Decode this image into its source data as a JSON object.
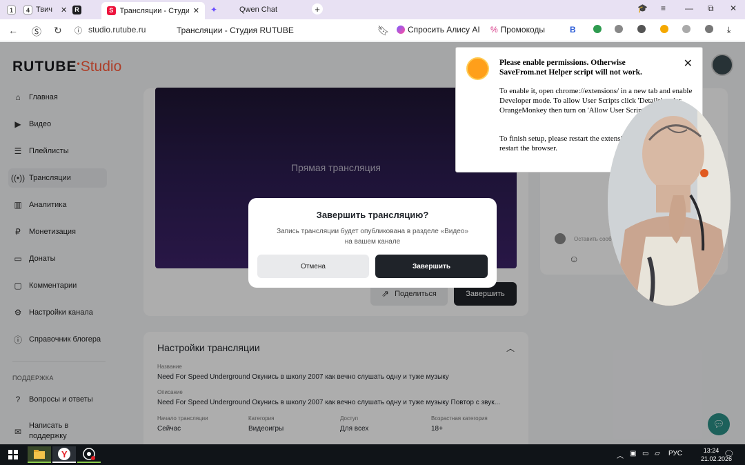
{
  "browser": {
    "tabs": [
      {
        "label": "1",
        "kind": "counter"
      },
      {
        "label": "4",
        "kind": "counter"
      },
      {
        "label": "Твич",
        "kind": "tab"
      },
      {
        "label": "R",
        "kind": "icon"
      },
      {
        "label": "Трансляции - Студия R",
        "kind": "active"
      },
      {
        "label": "Qwen Chat",
        "kind": "tab"
      }
    ],
    "url_host": "studio.rutube.ru",
    "page_title": "Трансляции - Студия RUTUBE",
    "bookmarks": {
      "alice": "Спросить Алису AI",
      "promo": "Промокоды",
      "b": "B"
    }
  },
  "logo": {
    "brand": "RUTUBE",
    "product": "Studio"
  },
  "sidebar": {
    "items": [
      {
        "label": "Главная",
        "icon": "home-icon"
      },
      {
        "label": "Видео",
        "icon": "video-icon"
      },
      {
        "label": "Плейлисты",
        "icon": "playlist-icon"
      },
      {
        "label": "Трансляции",
        "icon": "broadcast-icon",
        "active": true
      },
      {
        "label": "Аналитика",
        "icon": "analytics-icon"
      },
      {
        "label": "Монетизация",
        "icon": "ruble-icon"
      },
      {
        "label": "Донаты",
        "icon": "donate-icon"
      },
      {
        "label": "Комментарии",
        "icon": "comment-icon"
      },
      {
        "label": "Настройки канала",
        "icon": "settings-icon"
      },
      {
        "label": "Справочник блогера",
        "icon": "info-icon"
      }
    ],
    "support_label": "ПОДДЕРЖКА",
    "support_items": [
      {
        "label": "Вопросы и ответы",
        "icon": "help-icon"
      },
      {
        "label": "Написать в поддержку",
        "icon": "mail-icon"
      }
    ]
  },
  "stream": {
    "player_label": "Прямая трансляция",
    "share_label": "Поделиться",
    "finish_label": "Завершить"
  },
  "chat": {
    "placeholder": "Оставить сооб"
  },
  "settings": {
    "title": "Настройки трансляции",
    "name_label": "Название",
    "name_value": "Need For Speed Underground Окунись в школу 2007 как вечно слушать одну и туже музыку",
    "desc_label": "Описание",
    "desc_value": "Need For Speed Underground Окунись в школу 2007 как вечно слушать одну и туже музыку Повтор с звук...",
    "fields": [
      {
        "label": "Начало трансляции",
        "value": "Сейчас"
      },
      {
        "label": "Категория",
        "value": "Видеоигры"
      },
      {
        "label": "Доступ",
        "value": "Для всех"
      },
      {
        "label": "Возрастная категория",
        "value": "18+"
      }
    ]
  },
  "modal": {
    "title": "Завершить трансляцию?",
    "text": "Запись трансляции будет опубликована в разделе «Видео» на вашем канале",
    "cancel": "Отмена",
    "confirm": "Завершить"
  },
  "popup": {
    "title": "Please enable permissions. Otherwise SaveFrom.net Helper script will not work.",
    "body1": "To enable it, open chrome://extensions/ in a new tab and enable Developer mode. To allow User Scripts click 'Details' under OrangeMonkey then turn on 'Allow User Scripts' toggle.",
    "body2": "To finish setup, please restart the extension (turn off and on) or restart the browser."
  },
  "taskbar": {
    "lang": "РУС",
    "time": "13:24",
    "date": "21.02.2026"
  },
  "colors": {
    "accent": "#ff5c3c",
    "dark_button": "#1f2329",
    "tab_bar": "#e8e1f3"
  }
}
